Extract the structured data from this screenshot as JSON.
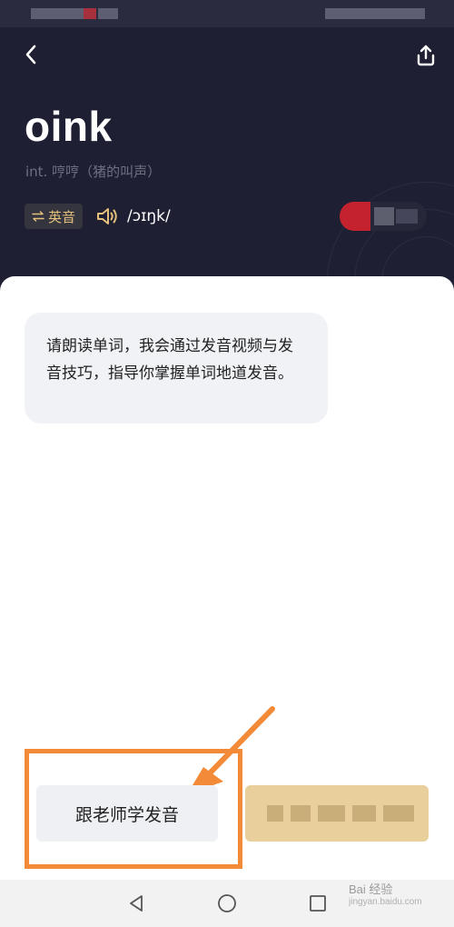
{
  "header": {
    "word": "oink",
    "definition": "int. 哼哼（猪的叫声）",
    "accent_label": "英音",
    "accent_icon": "swap-icon",
    "phonetic": "/ɔɪŋk/",
    "speaker_icon": "speaker-icon",
    "accent_color": "#e4c07a"
  },
  "chat": {
    "message": "请朗读单词，我会通过发音视频与发音技巧，指导你掌握单词地道发音。"
  },
  "actions": {
    "learn_label": "跟老师学发音"
  },
  "watermark": {
    "line1": "Bai 经验",
    "line2": "jingyan.baidu.com"
  },
  "colors": {
    "header_bg": "#1e1f33",
    "highlight": "#f28a37",
    "gold": "#e8cf9c"
  }
}
